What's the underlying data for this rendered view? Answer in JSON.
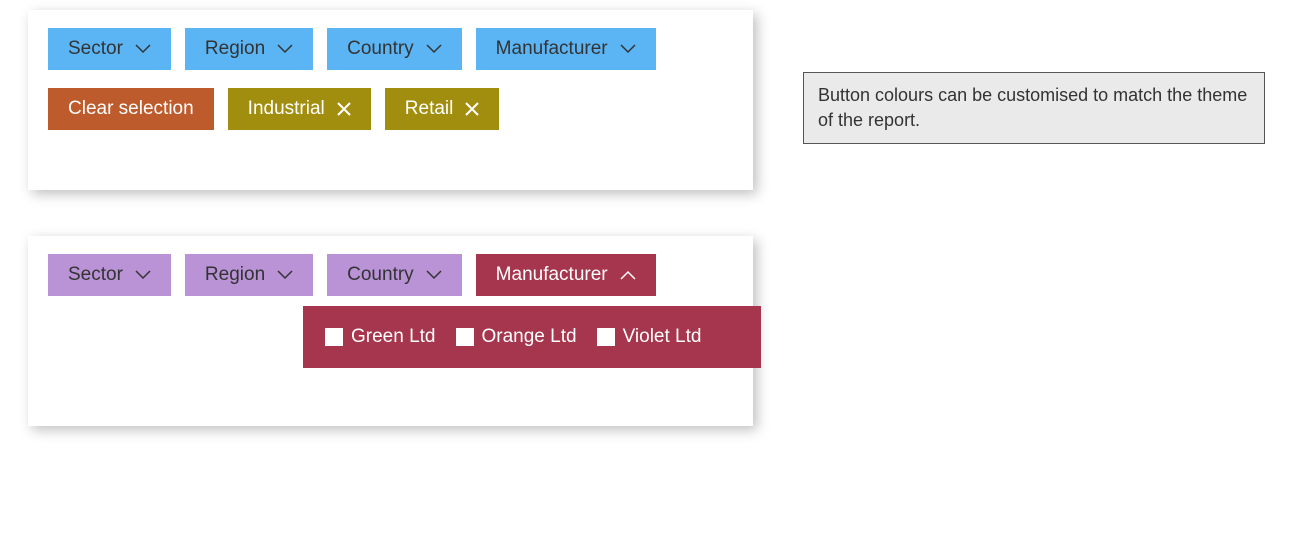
{
  "panel1": {
    "filters": {
      "sector": "Sector",
      "region": "Region",
      "country": "Country",
      "manufacturer": "Manufacturer"
    },
    "clear_label": "Clear selection",
    "chips": {
      "industrial": "Industrial",
      "retail": "Retail"
    }
  },
  "panel2": {
    "filters": {
      "sector": "Sector",
      "region": "Region",
      "country": "Country",
      "manufacturer": "Manufacturer"
    },
    "options": {
      "green": "Green Ltd",
      "orange": "Orange Ltd",
      "violet": "Violet Ltd"
    }
  },
  "note": "Button colours can be customised to match the theme of the report."
}
